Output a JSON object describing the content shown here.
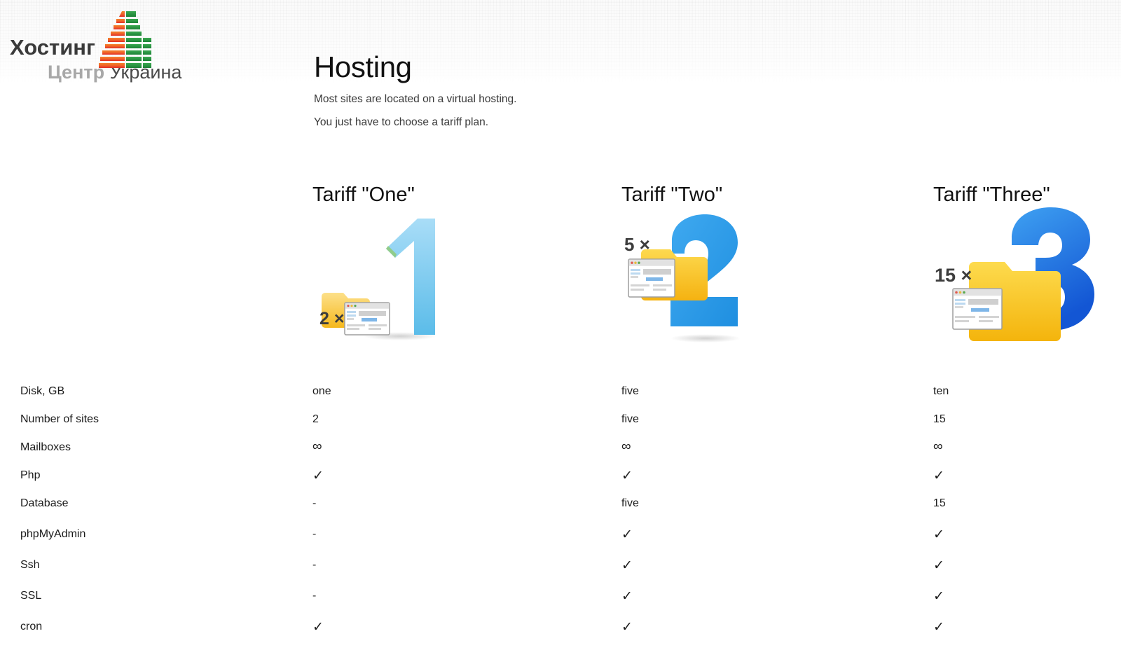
{
  "site": {
    "logo": {
      "line1": "Хостинг",
      "line2_bold": "Центр",
      "line2_regular": "Украина",
      "icon": "building-icon",
      "colors": {
        "left_tower_top": "#f07a2d",
        "left_tower_bottom": "#e0302a",
        "right_tower": "#2e9b46",
        "text_dark": "#3a3a3a",
        "text_gray": "#a8a8a8"
      }
    }
  },
  "page": {
    "title": "Hosting",
    "intro": [
      "Most sites are located on a virtual hosting.",
      "You just have to choose a tariff plan."
    ]
  },
  "tariffs": [
    {
      "heading": "Tariff \"One\"",
      "image": {
        "name": "tariff-one-illustration",
        "numeral": "1",
        "multiplier": "2 ×",
        "numeral_color": "#74c4ef",
        "numeral_color_light": "#a9ddf7",
        "folder_color": "#fbd04a"
      }
    },
    {
      "heading": "Tariff \"Two\"",
      "image": {
        "name": "tariff-two-illustration",
        "numeral": "2",
        "multiplier": "5 ×",
        "numeral_color": "#2e9ce8",
        "numeral_color_light": "#62bdf2",
        "folder_color": "#fbc72a"
      }
    },
    {
      "heading": "Tariff \"Three\"",
      "image": {
        "name": "tariff-three-illustration",
        "numeral": "3",
        "multiplier": "15 ×",
        "numeral_color": "#1f6fe0",
        "numeral_color_light": "#3ea6f0",
        "folder_color": "#f9c513"
      }
    }
  ],
  "spec_table": {
    "rows": [
      {
        "label": "Disk, GB",
        "one": "one",
        "two": "five",
        "three": "ten"
      },
      {
        "label": "Number of sites",
        "one": "2",
        "two": "five",
        "three": "15"
      },
      {
        "label": "Mailboxes",
        "one": "∞",
        "two": "∞",
        "three": "∞"
      },
      {
        "label": "Php",
        "one": "✓",
        "two": "✓",
        "three": "✓"
      },
      {
        "label": "Database",
        "one": "-",
        "two": "five",
        "three": "15"
      },
      {
        "label": "phpMyAdmin",
        "one": "-",
        "two": "✓",
        "three": "✓"
      },
      {
        "label": "Ssh",
        "one": "-",
        "two": "✓",
        "three": "✓"
      },
      {
        "label": "SSL",
        "one": "-",
        "two": "✓",
        "three": "✓"
      },
      {
        "label": "cron",
        "one": "✓",
        "two": "✓",
        "three": "✓"
      }
    ]
  }
}
